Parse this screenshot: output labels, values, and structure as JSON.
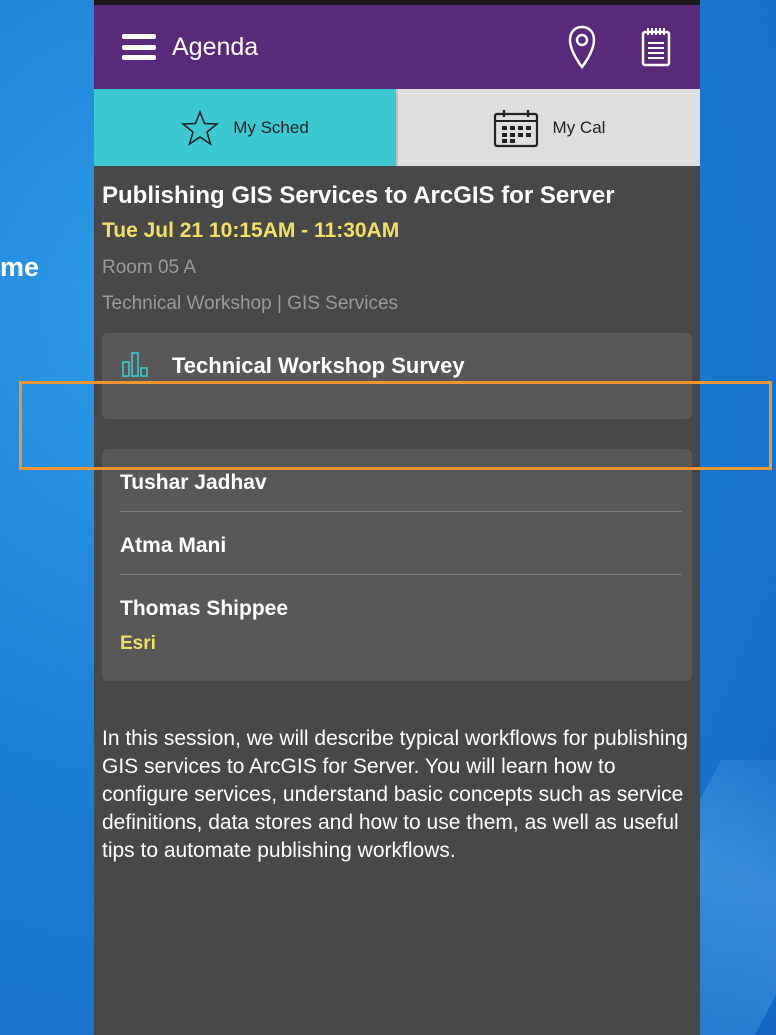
{
  "slide": {
    "partial_text": "me"
  },
  "appbar": {
    "title": "Agenda",
    "menu_icon": "hamburger-menu-icon",
    "map_icon": "map-pin-icon",
    "notes_icon": "notepad-icon"
  },
  "tabs": [
    {
      "label": "My Sched",
      "icon": "star-icon",
      "active": true
    },
    {
      "label": "My Cal",
      "icon": "calendar-icon",
      "active": false
    }
  ],
  "session": {
    "title": "Publishing GIS Services to ArcGIS for Server",
    "time": "Tue Jul 21 10:15AM - 11:30AM",
    "room": "Room 05 A",
    "track": "Technical Workshop | GIS Services"
  },
  "survey": {
    "label": "Technical Workshop Survey",
    "icon": "bar-chart-icon"
  },
  "speakers": [
    {
      "name": "Tushar Jadhav"
    },
    {
      "name": "Atma Mani"
    },
    {
      "name": "Thomas Shippee",
      "org": "Esri"
    }
  ],
  "description": "In this session, we will describe typical workflows for publishing GIS services to ArcGIS for Server. You will learn how to configure services, understand basic concepts such as service definitions, data stores and how to use them, as well as useful tips to automate publishing workflows.",
  "colors": {
    "appbar": "#592a7a",
    "tab_active": "#3bc8d1",
    "highlight": "#f0952f",
    "time": "#f2e066"
  }
}
